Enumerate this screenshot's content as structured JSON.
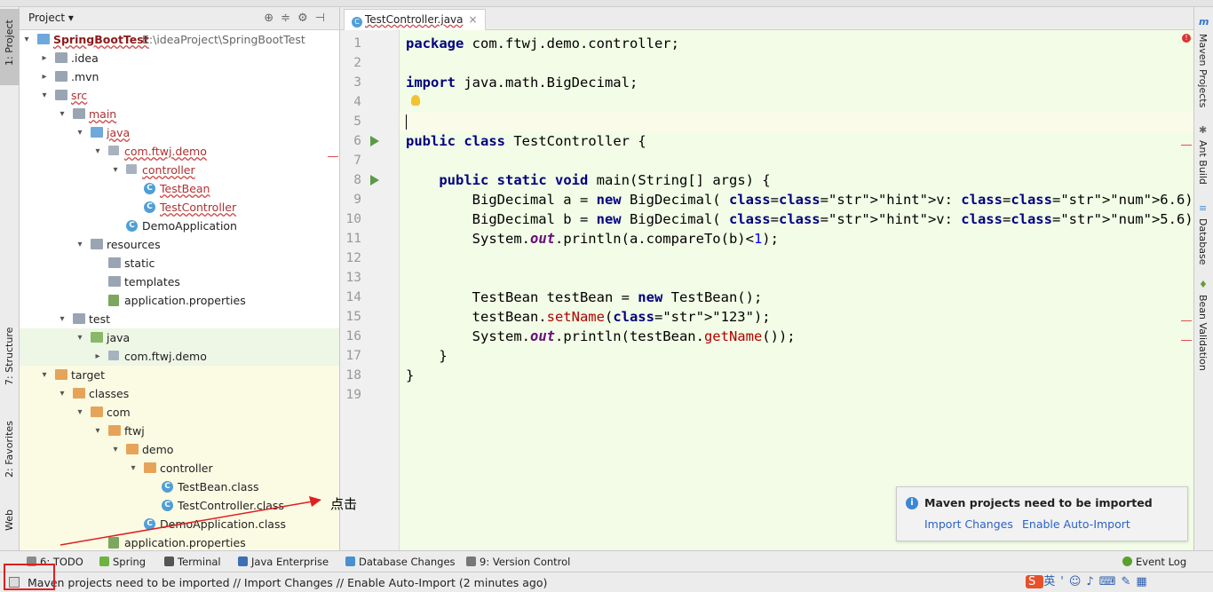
{
  "project_panel": {
    "title": "Project",
    "tree": [
      {
        "label": "SpringBootTest",
        "extra": "E:\\ideaProject\\SpringBootTest",
        "icon": "module-folder-icon"
      },
      {
        "label": ".idea",
        "icon": "folder-icon"
      },
      {
        "label": ".mvn",
        "icon": "folder-icon"
      },
      {
        "label": "src",
        "icon": "folder-icon"
      },
      {
        "label": "main",
        "icon": "folder-icon"
      },
      {
        "label": "java",
        "icon": "source-folder-icon"
      },
      {
        "label": "com.ftwj.demo",
        "icon": "package-icon"
      },
      {
        "label": "controller",
        "icon": "package-icon"
      },
      {
        "label": "TestBean",
        "icon": "class-icon"
      },
      {
        "label": "TestController",
        "icon": "class-icon"
      },
      {
        "label": "DemoApplication",
        "icon": "spring-class-icon"
      },
      {
        "label": "resources",
        "icon": "resources-folder-icon"
      },
      {
        "label": "static",
        "icon": "folder-icon"
      },
      {
        "label": "templates",
        "icon": "folder-icon"
      },
      {
        "label": "application.properties",
        "icon": "properties-icon"
      },
      {
        "label": "test",
        "icon": "folder-icon"
      },
      {
        "label": "java",
        "icon": "test-source-folder-icon"
      },
      {
        "label": "com.ftwj.demo",
        "icon": "package-icon"
      },
      {
        "label": "target",
        "icon": "excluded-folder-icon"
      },
      {
        "label": "classes",
        "icon": "excluded-folder-icon"
      },
      {
        "label": "com",
        "icon": "excluded-folder-icon"
      },
      {
        "label": "ftwj",
        "icon": "excluded-folder-icon"
      },
      {
        "label": "demo",
        "icon": "excluded-folder-icon"
      },
      {
        "label": "controller",
        "icon": "excluded-folder-icon"
      },
      {
        "label": "TestBean.class",
        "icon": "class-file-icon"
      },
      {
        "label": "TestController.class",
        "icon": "class-file-icon"
      },
      {
        "label": "DemoApplication.class",
        "icon": "class-file-icon"
      },
      {
        "label": "application.properties",
        "icon": "properties-icon"
      }
    ]
  },
  "left_tabs": [
    "1: Project",
    "7: Structure",
    "2: Favorites",
    "Web"
  ],
  "right_tabs": [
    "Maven Projects",
    "Ant Build",
    "Database",
    "Bean Validation"
  ],
  "editor": {
    "tab": "TestController.java",
    "line_numbers": [
      "1",
      "2",
      "3",
      "4",
      "5",
      "6",
      "7",
      "8",
      "9",
      "10",
      "11",
      "12",
      "13",
      "14",
      "15",
      "16",
      "17",
      "18",
      "19"
    ],
    "lines": [
      "package com.ftwj.demo.controller;",
      "",
      "import java.math.BigDecimal;",
      "",
      "",
      "public class TestController {",
      "",
      "    public static void main(String[] args) {",
      "        BigDecimal a = new BigDecimal( v: 6.6);",
      "        BigDecimal b = new BigDecimal( v: 5.6);",
      "        System.out.println(a.compareTo(b)<1);",
      "",
      "",
      "        TestBean testBean = new TestBean();",
      "        testBean.setName(\"123\");",
      "        System.out.println(testBean.getName());",
      "    }",
      "}",
      ""
    ]
  },
  "notification": {
    "title": "Maven projects need to be imported",
    "link_import": "Import Changes",
    "link_auto": "Enable Auto-Import"
  },
  "annotation_text": "点击",
  "tool_windows": [
    "6: TODO",
    "Spring",
    "Terminal",
    "Java Enterprise",
    "Database Changes",
    "9: Version Control",
    "Event Log"
  ],
  "status_text": "Maven projects need to be imported // Import Changes // Enable Auto-Import (2 minutes ago)",
  "colors": {
    "code_bg": "#f2fce6",
    "keyword": "#000080",
    "string": "#008000",
    "link": "#2a62c8",
    "annotation_red": "#e01f1f"
  }
}
